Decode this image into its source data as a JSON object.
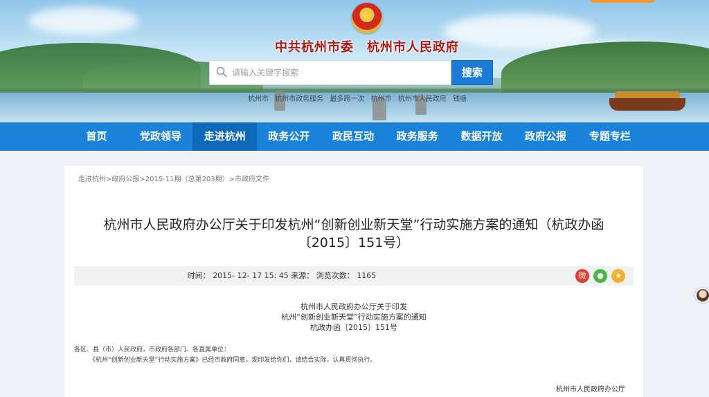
{
  "header": {
    "site_title": "中共杭州市委　杭州市人民政府",
    "search": {
      "placeholder": "请输入关键字搜索",
      "button_label": "搜索"
    },
    "hotwords": [
      "杭州市",
      "杭州市政务服务",
      "最多跑一次",
      "杭州市",
      "杭州市人民政府",
      "钱塘"
    ]
  },
  "nav": {
    "items": [
      {
        "label": "首页"
      },
      {
        "label": "党政领导"
      },
      {
        "label": "走进杭州",
        "active": true
      },
      {
        "label": "政务公开"
      },
      {
        "label": "政民互动"
      },
      {
        "label": "政务服务"
      },
      {
        "label": "数据开放"
      },
      {
        "label": "政府公报"
      },
      {
        "label": "专题专栏"
      }
    ]
  },
  "breadcrumb": {
    "items": [
      "走进杭州",
      "政府公报",
      "2015-11期（总第203期）",
      "市政府文件"
    ],
    "separator": ">"
  },
  "article": {
    "title_line1": "杭州市人民政府办公厅关于印发杭州“创新创业新天堂”行动实施方案的通知（杭政办函",
    "title_line2": "〔2015〕151号）",
    "meta": {
      "time_label": "时间：",
      "time_value": "2015- 12- 17 15: 45",
      "source_label": "来源：",
      "views_label": "浏览次数：",
      "views_value": "1165"
    },
    "share": {
      "weibo_icon": "weibo-icon",
      "wechat_icon": "wechat-icon",
      "favorite_icon": "star-icon"
    },
    "body_heading": [
      "杭州市人民政府办公厅关于印发",
      "杭州“创新创业新天堂”行动实施方案的通知",
      "杭政办函〔2015〕151号"
    ],
    "body_para1": "各区、县（市）人民政府，市政府各部门、各直属单位：",
    "body_para2": "《杭州“创新创业新天堂”行动实施方案》已经市政府同意，现印发给你们，请结合实际，认真贯彻执行。",
    "signer": "杭州市人民政府办公厅"
  },
  "colors": {
    "nav_bg": "#1a82d9",
    "nav_active": "#0f69bb",
    "search_button": "#1a7bd8",
    "title_red": "#b01a12"
  }
}
